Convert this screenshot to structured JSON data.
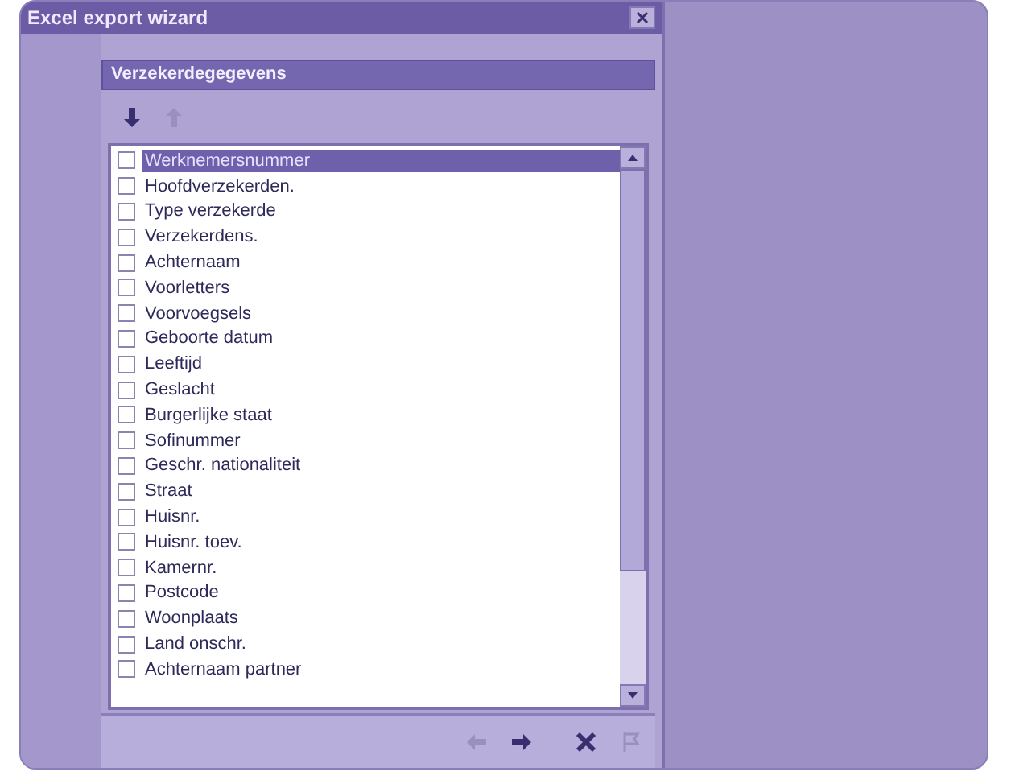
{
  "window": {
    "title": "Excel export wizard"
  },
  "panel": {
    "title": "Verzekerdegegevens"
  },
  "toolbar": [
    {
      "kind": "down",
      "disabled": false
    },
    {
      "kind": "up",
      "disabled": true
    }
  ],
  "fields": [
    {
      "label": "Werknemersnummer",
      "checked": false,
      "selected": true
    },
    {
      "label": "Hoofdverzekerden.",
      "checked": false,
      "selected": false
    },
    {
      "label": "Type verzekerde",
      "checked": false,
      "selected": false
    },
    {
      "label": "Verzekerdens.",
      "checked": false,
      "selected": false
    },
    {
      "label": "Achternaam",
      "checked": false,
      "selected": false
    },
    {
      "label": "Voorletters",
      "checked": false,
      "selected": false
    },
    {
      "label": "Voorvoegsels",
      "checked": false,
      "selected": false
    },
    {
      "label": "Geboorte datum",
      "checked": false,
      "selected": false
    },
    {
      "label": "Leeftijd",
      "checked": false,
      "selected": false
    },
    {
      "label": "Geslacht",
      "checked": false,
      "selected": false
    },
    {
      "label": "Burgerlijke staat",
      "checked": false,
      "selected": false
    },
    {
      "label": "Sofinummer",
      "checked": false,
      "selected": false
    },
    {
      "label": "Geschr. nationaliteit",
      "checked": false,
      "selected": false
    },
    {
      "label": "Straat",
      "checked": false,
      "selected": false
    },
    {
      "label": "Huisnr.",
      "checked": false,
      "selected": false
    },
    {
      "label": "Huisnr. toev.",
      "checked": false,
      "selected": false
    },
    {
      "label": "Kamernr.",
      "checked": false,
      "selected": false
    },
    {
      "label": "Postcode",
      "checked": false,
      "selected": false
    },
    {
      "label": "Woonplaats",
      "checked": false,
      "selected": false
    },
    {
      "label": "Land onschr.",
      "checked": false,
      "selected": false
    },
    {
      "label": "Achternaam partner",
      "checked": false,
      "selected": false
    }
  ],
  "nav": [
    {
      "kind": "back",
      "disabled": true
    },
    {
      "kind": "next",
      "disabled": false
    },
    {
      "kind": "cancel",
      "disabled": false
    },
    {
      "kind": "finish",
      "disabled": true
    }
  ]
}
